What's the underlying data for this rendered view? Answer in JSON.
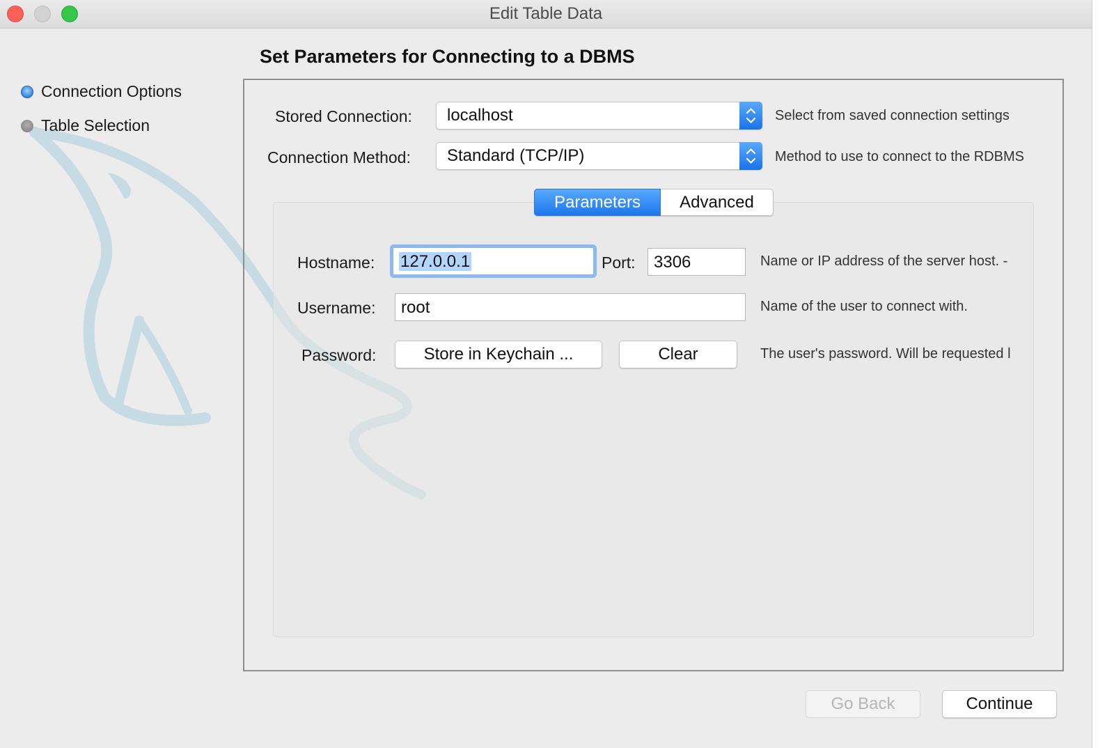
{
  "window": {
    "title": "Edit Table Data"
  },
  "sidebar": {
    "steps": [
      {
        "label": "Connection Options",
        "state": "active"
      },
      {
        "label": "Table Selection",
        "state": "inactive"
      }
    ]
  },
  "main": {
    "heading": "Set Parameters for Connecting to a DBMS",
    "stored_connection": {
      "label": "Stored Connection:",
      "value": "localhost",
      "hint": "Select from saved connection settings"
    },
    "connection_method": {
      "label": "Connection Method:",
      "value": "Standard (TCP/IP)",
      "hint": "Method to use to connect to the RDBMS"
    },
    "tabs": [
      {
        "label": "Parameters",
        "selected": true
      },
      {
        "label": "Advanced",
        "selected": false
      }
    ],
    "params": {
      "hostname_label": "Hostname:",
      "hostname_value": "127.0.0.1",
      "port_label": "Port:",
      "port_value": "3306",
      "hostname_hint": "Name or IP address of the server host. -",
      "username_label": "Username:",
      "username_value": "root",
      "username_hint": "Name of the user to connect with.",
      "password_label": "Password:",
      "store_keychain_label": "Store in Keychain ...",
      "clear_label": "Clear",
      "password_hint": "The user's password. Will be requested l"
    }
  },
  "footer": {
    "go_back_label": "Go Back",
    "continue_label": "Continue"
  },
  "colors": {
    "accent": "#1d77ec",
    "window_bg": "#ececec",
    "watermark": "#c9dde4"
  },
  "icons": {
    "watermark": "mysql-dolphin-logo",
    "stepper": "up-down-chevron-icon"
  }
}
